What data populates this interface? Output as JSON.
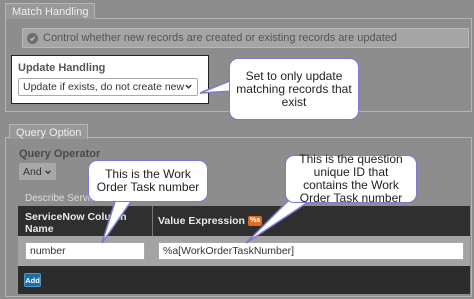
{
  "match_handling": {
    "section_label": "Match Handling",
    "info_text": "Control whether new records are created or existing records are updated",
    "update_handling_label": "Update Handling",
    "update_handling_value": "Update if exists, do not create new"
  },
  "query_option": {
    "section_label": "Query Option",
    "operator_label": "Query Operator",
    "operator_value": "And",
    "describe_text": "Describe Servic"
  },
  "table": {
    "col1_header": "ServiceNow Column Name",
    "col2_header": "Value Expression",
    "col2_icon_text": "%a",
    "row1_col1": "number",
    "row1_col2": "%a[WorkOrderTaskNumber]",
    "add_label": "Add"
  },
  "callouts": {
    "update": "Set to only update matching records that exist",
    "task_number": "This is the Work Order Task number",
    "question_id": "This is the question unique ID that contains the Work Order Task number"
  }
}
